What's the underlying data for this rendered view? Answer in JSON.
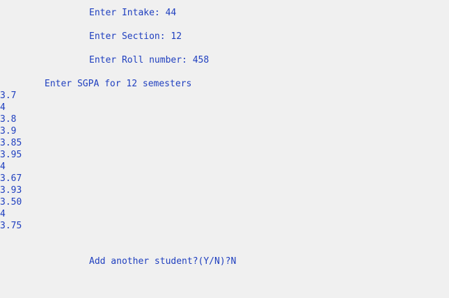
{
  "prompts": {
    "intake": "Enter Intake: 44",
    "section": "Enter Section: 12",
    "roll": "Enter Roll number: 458",
    "sgpa_header": "Enter SGPA for 12 semesters"
  },
  "sgpa_values": [
    "3.7",
    "4",
    "3.8",
    "3.9",
    "3.85",
    "3.95",
    "4",
    "3.67",
    "3.93",
    "3.50",
    "4",
    "3.75"
  ],
  "footer": {
    "question": "Add another student?(Y/N)?N"
  }
}
